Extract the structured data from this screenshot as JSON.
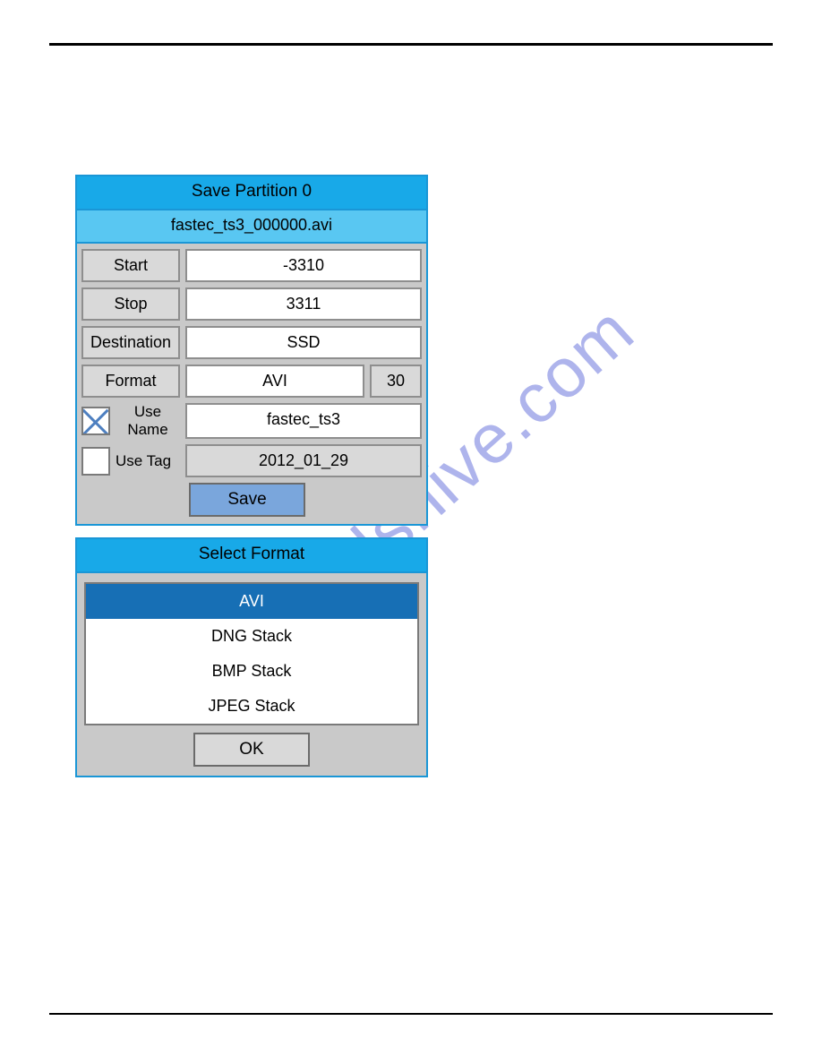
{
  "watermark": "manualshive.com",
  "savePanel": {
    "title": "Save Partition 0",
    "filename": "fastec_ts3_000000.avi",
    "start": {
      "label": "Start",
      "value": "-3310"
    },
    "stop": {
      "label": "Stop",
      "value": "3311"
    },
    "destination": {
      "label": "Destination",
      "value": "SSD"
    },
    "format": {
      "label": "Format",
      "value": "AVI",
      "fps": "30"
    },
    "useName": {
      "label": "Use Name",
      "value": "fastec_ts3",
      "checked": true
    },
    "useTag": {
      "label": "Use Tag",
      "value": "2012_01_29",
      "checked": false
    },
    "saveLabel": "Save"
  },
  "formatPanel": {
    "title": "Select Format",
    "items": [
      {
        "label": "AVI",
        "selected": true
      },
      {
        "label": "DNG Stack",
        "selected": false
      },
      {
        "label": "BMP Stack",
        "selected": false
      },
      {
        "label": "JPEG Stack",
        "selected": false
      }
    ],
    "okLabel": "OK"
  }
}
